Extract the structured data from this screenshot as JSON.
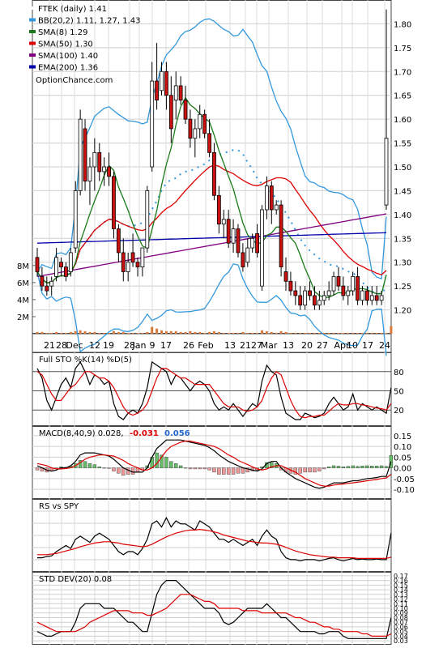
{
  "chart_data": {
    "type": "candlestick",
    "ticker": "FTEK",
    "legend": [
      {
        "label": "FTEK (daily) 1.41",
        "color": "#ffffff"
      },
      {
        "label": "BB(20,2) 1.11, 1.27, 1.43",
        "color": "#3399dd"
      },
      {
        "label": "SMA(8) 1.29",
        "color": "#1a7a1a"
      },
      {
        "label": "SMA(50) 1.30",
        "color": "#dd0000"
      },
      {
        "label": "SMA(100) 1.40",
        "color": "#800080"
      },
      {
        "label": "EMA(200) 1.36",
        "color": "#0000aa"
      }
    ],
    "watermark": "OptionChance.com",
    "price_axis": {
      "ticks": [
        "1.80",
        "1.75",
        "1.70",
        "1.65",
        "1.60",
        "1.55",
        "1.50",
        "1.45",
        "1.40",
        "1.35",
        "1.30",
        "1.25",
        "1.20"
      ],
      "range": [
        1.15,
        1.85
      ]
    },
    "volume_axis": {
      "ticks": [
        "8M",
        "6M",
        "4M",
        "2M"
      ],
      "range": [
        0,
        9.5
      ]
    },
    "date_labels": [
      "21",
      "28",
      "Dec",
      "12",
      "19",
      "28",
      "Jan",
      "9",
      "17",
      "26",
      "Feb",
      "13",
      "21",
      "27",
      "Mar",
      "13",
      "20",
      "27",
      "Apr",
      "10",
      "17",
      "24"
    ],
    "date_positions": [
      61,
      76,
      92,
      117,
      134,
      160,
      172,
      188,
      205,
      233,
      254,
      284,
      303,
      317,
      332,
      356,
      379,
      398,
      422,
      435,
      454,
      475
    ],
    "candles": [
      {
        "o": 1.31,
        "h": 1.33,
        "l": 1.27,
        "c": 1.28
      },
      {
        "o": 1.27,
        "h": 1.29,
        "l": 1.24,
        "c": 1.25
      },
      {
        "o": 1.25,
        "h": 1.27,
        "l": 1.23,
        "c": 1.24
      },
      {
        "o": 1.25,
        "h": 1.27,
        "l": 1.23,
        "c": 1.26
      },
      {
        "o": 1.27,
        "h": 1.33,
        "l": 1.26,
        "c": 1.31
      },
      {
        "o": 1.3,
        "h": 1.31,
        "l": 1.27,
        "c": 1.29
      },
      {
        "o": 1.29,
        "h": 1.3,
        "l": 1.26,
        "c": 1.27
      },
      {
        "o": 1.28,
        "h": 1.33,
        "l": 1.27,
        "c": 1.32
      },
      {
        "o": 1.33,
        "h": 1.47,
        "l": 1.32,
        "c": 1.45
      },
      {
        "o": 1.45,
        "h": 1.62,
        "l": 1.44,
        "c": 1.6
      },
      {
        "o": 1.58,
        "h": 1.6,
        "l": 1.45,
        "c": 1.47
      },
      {
        "o": 1.47,
        "h": 1.52,
        "l": 1.42,
        "c": 1.5
      },
      {
        "o": 1.5,
        "h": 1.56,
        "l": 1.45,
        "c": 1.53
      },
      {
        "o": 1.53,
        "h": 1.55,
        "l": 1.47,
        "c": 1.49
      },
      {
        "o": 1.49,
        "h": 1.52,
        "l": 1.46,
        "c": 1.5
      },
      {
        "o": 1.5,
        "h": 1.53,
        "l": 1.46,
        "c": 1.48
      },
      {
        "o": 1.48,
        "h": 1.49,
        "l": 1.35,
        "c": 1.37
      },
      {
        "o": 1.37,
        "h": 1.38,
        "l": 1.3,
        "c": 1.32
      },
      {
        "o": 1.32,
        "h": 1.35,
        "l": 1.26,
        "c": 1.28
      },
      {
        "o": 1.28,
        "h": 1.32,
        "l": 1.26,
        "c": 1.3
      },
      {
        "o": 1.32,
        "h": 1.36,
        "l": 1.29,
        "c": 1.3
      },
      {
        "o": 1.3,
        "h": 1.31,
        "l": 1.27,
        "c": 1.29
      },
      {
        "o": 1.29,
        "h": 1.33,
        "l": 1.27,
        "c": 1.33
      },
      {
        "o": 1.33,
        "h": 1.46,
        "l": 1.32,
        "c": 1.45
      },
      {
        "o": 1.5,
        "h": 1.72,
        "l": 1.49,
        "c": 1.68
      },
      {
        "o": 1.68,
        "h": 1.76,
        "l": 1.62,
        "c": 1.64
      },
      {
        "o": 1.66,
        "h": 1.72,
        "l": 1.65,
        "c": 1.7
      },
      {
        "o": 1.7,
        "h": 1.72,
        "l": 1.62,
        "c": 1.65
      },
      {
        "o": 1.65,
        "h": 1.69,
        "l": 1.55,
        "c": 1.58
      },
      {
        "o": 1.64,
        "h": 1.7,
        "l": 1.6,
        "c": 1.67
      },
      {
        "o": 1.67,
        "h": 1.69,
        "l": 1.63,
        "c": 1.64
      },
      {
        "o": 1.64,
        "h": 1.67,
        "l": 1.59,
        "c": 1.6
      },
      {
        "o": 1.6,
        "h": 1.62,
        "l": 1.54,
        "c": 1.56
      },
      {
        "o": 1.56,
        "h": 1.6,
        "l": 1.52,
        "c": 1.58
      },
      {
        "o": 1.58,
        "h": 1.63,
        "l": 1.56,
        "c": 1.61
      },
      {
        "o": 1.61,
        "h": 1.62,
        "l": 1.56,
        "c": 1.57
      },
      {
        "o": 1.57,
        "h": 1.6,
        "l": 1.52,
        "c": 1.53
      },
      {
        "o": 1.53,
        "h": 1.55,
        "l": 1.43,
        "c": 1.44
      },
      {
        "o": 1.44,
        "h": 1.46,
        "l": 1.36,
        "c": 1.38
      },
      {
        "o": 1.38,
        "h": 1.41,
        "l": 1.35,
        "c": 1.39
      },
      {
        "o": 1.39,
        "h": 1.41,
        "l": 1.33,
        "c": 1.34
      },
      {
        "o": 1.34,
        "h": 1.39,
        "l": 1.32,
        "c": 1.37
      },
      {
        "o": 1.37,
        "h": 1.38,
        "l": 1.31,
        "c": 1.32
      },
      {
        "o": 1.32,
        "h": 1.34,
        "l": 1.28,
        "c": 1.29
      },
      {
        "o": 1.3,
        "h": 1.35,
        "l": 1.29,
        "c": 1.33
      },
      {
        "o": 1.33,
        "h": 1.36,
        "l": 1.32,
        "c": 1.35
      },
      {
        "o": 1.36,
        "h": 1.38,
        "l": 1.31,
        "c": 1.32
      },
      {
        "o": 1.25,
        "h": 1.42,
        "l": 1.24,
        "c": 1.41
      },
      {
        "o": 1.41,
        "h": 1.48,
        "l": 1.39,
        "c": 1.46
      },
      {
        "o": 1.46,
        "h": 1.47,
        "l": 1.38,
        "c": 1.41
      },
      {
        "o": 1.41,
        "h": 1.43,
        "l": 1.4,
        "c": 1.42
      },
      {
        "o": 1.42,
        "h": 1.43,
        "l": 1.27,
        "c": 1.29
      },
      {
        "o": 1.28,
        "h": 1.31,
        "l": 1.24,
        "c": 1.26
      },
      {
        "o": 1.26,
        "h": 1.28,
        "l": 1.23,
        "c": 1.24
      },
      {
        "o": 1.24,
        "h": 1.26,
        "l": 1.21,
        "c": 1.23
      },
      {
        "o": 1.23,
        "h": 1.25,
        "l": 1.2,
        "c": 1.21
      },
      {
        "o": 1.21,
        "h": 1.25,
        "l": 1.2,
        "c": 1.24
      },
      {
        "o": 1.24,
        "h": 1.26,
        "l": 1.22,
        "c": 1.23
      },
      {
        "o": 1.23,
        "h": 1.25,
        "l": 1.2,
        "c": 1.21
      },
      {
        "o": 1.21,
        "h": 1.24,
        "l": 1.2,
        "c": 1.22
      },
      {
        "o": 1.22,
        "h": 1.24,
        "l": 1.21,
        "c": 1.23
      },
      {
        "o": 1.23,
        "h": 1.26,
        "l": 1.22,
        "c": 1.24
      },
      {
        "o": 1.24,
        "h": 1.28,
        "l": 1.23,
        "c": 1.27
      },
      {
        "o": 1.27,
        "h": 1.29,
        "l": 1.24,
        "c": 1.25
      },
      {
        "o": 1.25,
        "h": 1.27,
        "l": 1.22,
        "c": 1.23
      },
      {
        "o": 1.23,
        "h": 1.25,
        "l": 1.21,
        "c": 1.24
      },
      {
        "o": 1.24,
        "h": 1.28,
        "l": 1.23,
        "c": 1.27
      },
      {
        "o": 1.27,
        "h": 1.29,
        "l": 1.21,
        "c": 1.22
      },
      {
        "o": 1.22,
        "h": 1.25,
        "l": 1.21,
        "c": 1.24
      },
      {
        "o": 1.24,
        "h": 1.25,
        "l": 1.21,
        "c": 1.22
      },
      {
        "o": 1.22,
        "h": 1.25,
        "l": 1.21,
        "c": 1.23
      },
      {
        "o": 1.23,
        "h": 1.25,
        "l": 1.21,
        "c": 1.22
      },
      {
        "o": 1.22,
        "h": 1.24,
        "l": 1.21,
        "c": 1.23
      },
      {
        "o": 1.42,
        "h": 1.83,
        "l": 1.41,
        "c": 1.56
      }
    ],
    "volume_m": [
      0.2,
      0.2,
      0.1,
      0.1,
      0.2,
      0.1,
      0.1,
      0.2,
      0.3,
      0.4,
      0.3,
      0.2,
      0.2,
      0.1,
      0.1,
      0.1,
      0.3,
      0.2,
      0.2,
      0.1,
      0.1,
      0.1,
      0.1,
      0.2,
      0.8,
      0.6,
      0.4,
      0.3,
      0.3,
      0.3,
      0.2,
      0.2,
      0.3,
      0.2,
      0.2,
      0.1,
      0.2,
      0.3,
      0.2,
      0.1,
      0.1,
      0.1,
      0.1,
      0.2,
      0.1,
      0.1,
      0.1,
      0.4,
      0.3,
      0.2,
      0.1,
      0.3,
      0.2,
      0.1,
      0.1,
      0.1,
      0.1,
      0.1,
      0.1,
      0.1,
      0.1,
      0.1,
      0.1,
      0.1,
      0.1,
      0.1,
      0.1,
      0.1,
      0.1,
      0.1,
      0.1,
      0.1,
      0.1,
      0.1,
      0.9
    ],
    "stochastic": {
      "title": "Full STO %K(14) %D(5)",
      "ticks": [
        "80",
        "50",
        "20"
      ],
      "range": [
        0,
        100
      ],
      "k": [
        85,
        70,
        35,
        20,
        40,
        60,
        70,
        55,
        85,
        95,
        80,
        60,
        75,
        70,
        60,
        65,
        30,
        10,
        5,
        15,
        20,
        15,
        30,
        55,
        95,
        90,
        85,
        80,
        60,
        75,
        70,
        60,
        50,
        60,
        65,
        60,
        50,
        30,
        20,
        25,
        20,
        30,
        20,
        10,
        20,
        30,
        25,
        65,
        90,
        80,
        75,
        40,
        15,
        10,
        5,
        5,
        15,
        12,
        8,
        10,
        15,
        30,
        40,
        30,
        20,
        25,
        45,
        20,
        30,
        25,
        20,
        25,
        20,
        15,
        55
      ],
      "d": [
        80,
        75,
        60,
        45,
        35,
        35,
        45,
        55,
        60,
        70,
        80,
        80,
        75,
        70,
        70,
        65,
        55,
        40,
        25,
        15,
        12,
        15,
        20,
        30,
        50,
        70,
        85,
        85,
        80,
        75,
        70,
        70,
        65,
        60,
        60,
        60,
        60,
        50,
        40,
        30,
        25,
        25,
        25,
        20,
        18,
        20,
        25,
        35,
        55,
        70,
        80,
        75,
        55,
        35,
        20,
        10,
        8,
        10,
        10,
        12,
        12,
        18,
        25,
        30,
        28,
        28,
        30,
        30,
        28,
        27,
        25,
        23,
        22,
        20,
        30
      ]
    },
    "macd": {
      "title": "MACD(8,40,9) 0.028,",
      "values_label": [
        "-0.031",
        "0.056"
      ],
      "values_label_colors": [
        "#dd0000",
        "#2266cc"
      ],
      "ticks": [
        "0.15",
        "0.10",
        "0.05",
        "0.00",
        "-0.05",
        "-0.10"
      ],
      "range": [
        -0.13,
        0.18
      ],
      "macd": [
        0.01,
        0.0,
        -0.01,
        -0.015,
        -0.01,
        0.0,
        0.0,
        0.01,
        0.03,
        0.06,
        0.07,
        0.07,
        0.07,
        0.065,
        0.06,
        0.055,
        0.04,
        0.02,
        0.0,
        -0.01,
        -0.02,
        -0.02,
        -0.02,
        0.0,
        0.05,
        0.09,
        0.11,
        0.13,
        0.13,
        0.13,
        0.13,
        0.125,
        0.12,
        0.115,
        0.11,
        0.105,
        0.095,
        0.08,
        0.06,
        0.045,
        0.03,
        0.02,
        0.01,
        0.0,
        -0.005,
        -0.01,
        -0.015,
        -0.005,
        0.02,
        0.03,
        0.03,
        0.0,
        -0.02,
        -0.035,
        -0.05,
        -0.06,
        -0.07,
        -0.08,
        -0.09,
        -0.095,
        -0.09,
        -0.08,
        -0.07,
        -0.07,
        -0.07,
        -0.065,
        -0.06,
        -0.06,
        -0.055,
        -0.05,
        -0.048,
        -0.045,
        -0.04,
        -0.04,
        0.03
      ],
      "signal": [
        0.02,
        0.015,
        0.01,
        0.0,
        -0.005,
        -0.005,
        -0.003,
        0.0,
        0.01,
        0.025,
        0.04,
        0.05,
        0.055,
        0.06,
        0.06,
        0.058,
        0.055,
        0.045,
        0.035,
        0.02,
        0.01,
        0.0,
        -0.01,
        -0.01,
        0.0,
        0.02,
        0.05,
        0.08,
        0.1,
        0.11,
        0.12,
        0.125,
        0.125,
        0.12,
        0.115,
        0.11,
        0.105,
        0.1,
        0.09,
        0.075,
        0.06,
        0.05,
        0.035,
        0.025,
        0.015,
        0.005,
        -0.005,
        -0.01,
        -0.005,
        0.005,
        0.01,
        0.01,
        0.0,
        -0.01,
        -0.02,
        -0.035,
        -0.05,
        -0.06,
        -0.07,
        -0.08,
        -0.085,
        -0.085,
        -0.08,
        -0.078,
        -0.075,
        -0.072,
        -0.07,
        -0.067,
        -0.064,
        -0.06,
        -0.057,
        -0.054,
        -0.05,
        -0.047,
        -0.03
      ],
      "histogram": [
        -0.01,
        -0.015,
        -0.02,
        -0.015,
        -0.005,
        0.005,
        0.003,
        0.01,
        0.02,
        0.035,
        0.03,
        0.02,
        0.015,
        0.005,
        0.0,
        -0.003,
        -0.015,
        -0.025,
        -0.035,
        -0.03,
        -0.03,
        -0.02,
        -0.01,
        0.01,
        0.05,
        0.07,
        0.06,
        0.05,
        0.03,
        0.02,
        0.01,
        0.0,
        -0.005,
        -0.005,
        -0.005,
        -0.005,
        -0.01,
        -0.02,
        -0.03,
        -0.03,
        -0.03,
        -0.03,
        -0.025,
        -0.025,
        -0.02,
        -0.015,
        -0.01,
        0.005,
        0.025,
        0.025,
        0.02,
        -0.01,
        -0.02,
        -0.025,
        -0.03,
        -0.025,
        -0.02,
        -0.02,
        -0.02,
        -0.015,
        -0.005,
        0.005,
        0.01,
        0.008,
        0.005,
        0.007,
        0.01,
        0.007,
        0.009,
        0.01,
        0.009,
        0.009,
        0.01,
        0.007,
        0.058
      ]
    },
    "rs_spy": {
      "title": "RS vs SPY",
      "rs": [
        0.15,
        0.15,
        0.17,
        0.18,
        0.25,
        0.3,
        0.35,
        0.3,
        0.45,
        0.5,
        0.45,
        0.4,
        0.5,
        0.55,
        0.5,
        0.45,
        0.35,
        0.25,
        0.2,
        0.25,
        0.25,
        0.2,
        0.3,
        0.45,
        0.7,
        0.75,
        0.65,
        0.8,
        0.65,
        0.75,
        0.7,
        0.7,
        0.65,
        0.6,
        0.75,
        0.7,
        0.65,
        0.55,
        0.45,
        0.45,
        0.4,
        0.45,
        0.4,
        0.35,
        0.4,
        0.45,
        0.35,
        0.5,
        0.6,
        0.5,
        0.45,
        0.25,
        0.15,
        0.12,
        0.12,
        0.1,
        0.12,
        0.12,
        0.12,
        0.1,
        0.12,
        0.14,
        0.15,
        0.12,
        0.1,
        0.12,
        0.14,
        0.12,
        0.13,
        0.12,
        0.12,
        0.13,
        0.12,
        0.12,
        0.55
      ],
      "ma": [
        0.2,
        0.2,
        0.2,
        0.21,
        0.22,
        0.24,
        0.26,
        0.28,
        0.3,
        0.33,
        0.35,
        0.37,
        0.39,
        0.4,
        0.41,
        0.41,
        0.4,
        0.39,
        0.37,
        0.36,
        0.35,
        0.34,
        0.33,
        0.34,
        0.37,
        0.41,
        0.45,
        0.49,
        0.52,
        0.55,
        0.57,
        0.59,
        0.6,
        0.6,
        0.61,
        0.6,
        0.59,
        0.57,
        0.55,
        0.52,
        0.5,
        0.48,
        0.46,
        0.44,
        0.42,
        0.41,
        0.4,
        0.39,
        0.39,
        0.38,
        0.37,
        0.35,
        0.32,
        0.29,
        0.26,
        0.24,
        0.22,
        0.2,
        0.19,
        0.18,
        0.17,
        0.16,
        0.16,
        0.15,
        0.15,
        0.15,
        0.15,
        0.14,
        0.14,
        0.14,
        0.14,
        0.14,
        0.14,
        0.14,
        0.16
      ]
    },
    "std_dev": {
      "title": "STD DEV(20) 0.08",
      "ticks": [
        "0.17",
        "0.16",
        "0.15",
        "0.14",
        "0.13",
        "0.12",
        "0.11",
        "0.10",
        "0.09",
        "0.08",
        "0.07",
        "0.06",
        "0.05",
        "0.04",
        "0.03"
      ],
      "range": [
        0.025,
        0.175
      ],
      "sd": [
        0.05,
        0.045,
        0.04,
        0.04,
        0.045,
        0.05,
        0.05,
        0.05,
        0.07,
        0.1,
        0.11,
        0.11,
        0.11,
        0.11,
        0.1,
        0.1,
        0.1,
        0.09,
        0.08,
        0.07,
        0.07,
        0.06,
        0.05,
        0.05,
        0.09,
        0.13,
        0.15,
        0.16,
        0.16,
        0.16,
        0.15,
        0.14,
        0.13,
        0.12,
        0.11,
        0.1,
        0.1,
        0.1,
        0.09,
        0.07,
        0.065,
        0.07,
        0.08,
        0.09,
        0.1,
        0.1,
        0.1,
        0.1,
        0.11,
        0.1,
        0.09,
        0.08,
        0.08,
        0.07,
        0.06,
        0.05,
        0.05,
        0.05,
        0.05,
        0.045,
        0.045,
        0.05,
        0.05,
        0.05,
        0.04,
        0.035,
        0.035,
        0.035,
        0.035,
        0.035,
        0.035,
        0.035,
        0.035,
        0.035,
        0.08
      ],
      "ma": [
        0.07,
        0.065,
        0.06,
        0.055,
        0.05,
        0.05,
        0.05,
        0.05,
        0.05,
        0.055,
        0.06,
        0.07,
        0.075,
        0.08,
        0.085,
        0.09,
        0.095,
        0.095,
        0.095,
        0.095,
        0.09,
        0.09,
        0.09,
        0.085,
        0.085,
        0.09,
        0.095,
        0.1,
        0.11,
        0.12,
        0.13,
        0.13,
        0.13,
        0.125,
        0.12,
        0.115,
        0.115,
        0.11,
        0.1,
        0.1,
        0.1,
        0.1,
        0.1,
        0.095,
        0.095,
        0.095,
        0.095,
        0.09,
        0.09,
        0.09,
        0.09,
        0.09,
        0.09,
        0.085,
        0.08,
        0.08,
        0.075,
        0.07,
        0.07,
        0.065,
        0.06,
        0.06,
        0.055,
        0.055,
        0.05,
        0.05,
        0.05,
        0.05,
        0.045,
        0.045,
        0.04,
        0.04,
        0.04,
        0.04,
        0.045
      ]
    }
  }
}
